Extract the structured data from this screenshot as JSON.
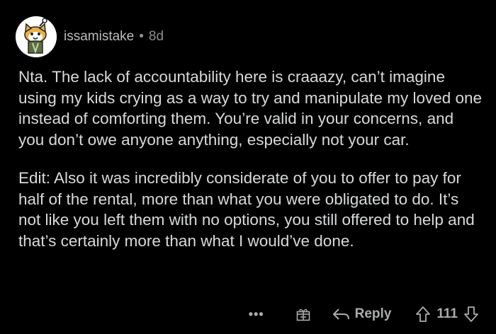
{
  "comment": {
    "username": "issamistake",
    "separator": "•",
    "age": "8d",
    "paragraphs": [
      "Nta. The lack of accountability here is craaazy, can’t imagine using my kids crying as a way to try and manipulate my loved one instead of comforting them. You’re valid in your concerns, and you don’t owe anyone anything, especially not your car.",
      "Edit: Also it was incredibly considerate of you to offer to pay for half of the rental, more than what you were obligated to do. It’s not like you left them with no options, you still offered to help and that’s certainly more than what I would’ve done."
    ]
  },
  "actions": {
    "more": "•••",
    "reply_label": "Reply",
    "vote_count": "111"
  },
  "icons": {
    "avatar": "snoo-avatar-icon",
    "award": "award-gift-icon",
    "reply": "reply-arrow-icon",
    "upvote": "upvote-arrow-icon",
    "downvote": "downvote-arrow-icon"
  },
  "colors": {
    "background": "#000000",
    "text": "#d7dadc",
    "muted": "#a9acae"
  }
}
